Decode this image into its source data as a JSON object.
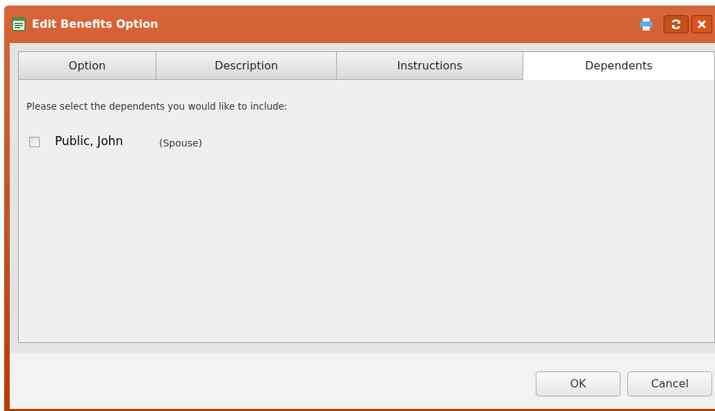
{
  "window": {
    "title": "Edit Benefits Option"
  },
  "tabs": [
    {
      "label": "Option",
      "selected": false
    },
    {
      "label": "Description",
      "selected": false
    },
    {
      "label": "Instructions",
      "selected": false
    },
    {
      "label": "Dependents",
      "selected": true
    }
  ],
  "prompt": "Please select the dependents you would like to include:",
  "dependents": [
    {
      "name": "Public, John",
      "relation": "(Spouse)",
      "checked": false
    }
  ],
  "buttons": [
    "OK",
    "Cancel"
  ]
}
